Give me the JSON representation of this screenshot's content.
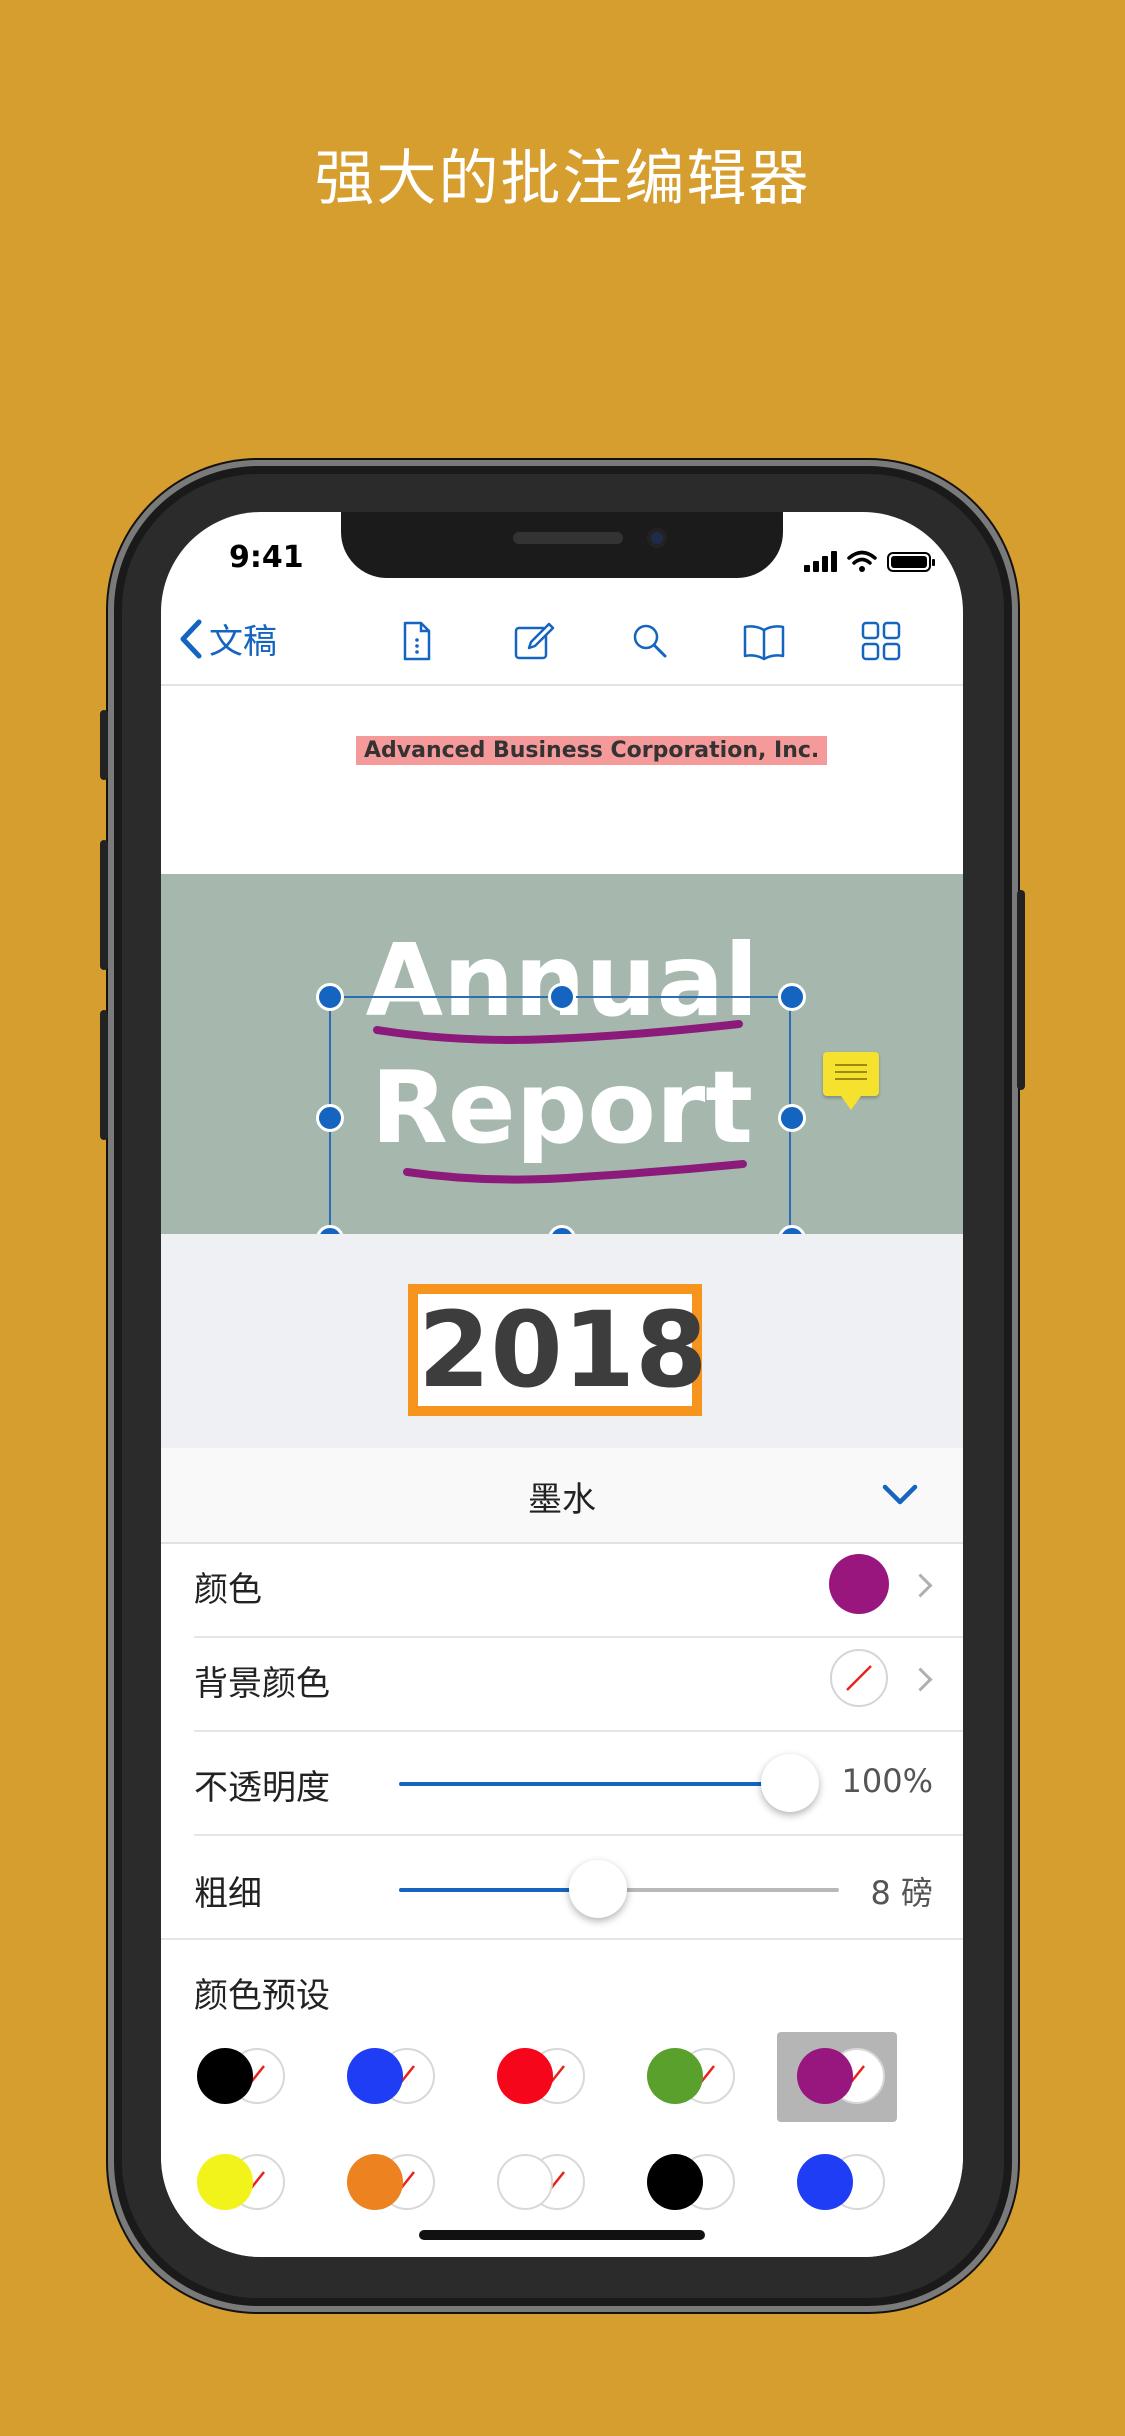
{
  "headline": "强大的批注编辑器",
  "status": {
    "time": "9:41"
  },
  "toolbar": {
    "back_label": "文稿",
    "icons": [
      "document-outline-icon",
      "edit-icon",
      "search-icon",
      "book-icon",
      "grid-icon"
    ]
  },
  "document": {
    "company": "Advanced Business Corporation, Inc.",
    "title_line1": "Annual",
    "title_line2": "Report",
    "year": "2018",
    "ink_color": "#8B1A7A",
    "note_color": "#F5E12E"
  },
  "ink_panel": {
    "title": "墨水",
    "color_label": "颜色",
    "color_value": "#99167F",
    "bg_color_label": "背景颜色",
    "opacity_label": "不透明度",
    "opacity_value": "100%",
    "opacity_fraction": 1.0,
    "thickness_label": "粗细",
    "thickness_value": "8 磅",
    "thickness_fraction": 0.45,
    "presets_label": "颜色预设",
    "presets": [
      {
        "color": "#000000",
        "slash": true,
        "selected": false
      },
      {
        "color": "#1E3DF5",
        "slash": true,
        "selected": false
      },
      {
        "color": "#F5061A",
        "slash": true,
        "selected": false
      },
      {
        "color": "#5AA02C",
        "slash": true,
        "selected": false
      },
      {
        "color": "#97177F",
        "slash": true,
        "selected": true
      },
      {
        "color": "#F1F31B",
        "slash": true,
        "selected": false
      },
      {
        "color": "#EC8220",
        "slash": true,
        "selected": false
      },
      {
        "color": "#FFFFFF",
        "slash": true,
        "selected": false
      },
      {
        "color": "#000000",
        "slash": false,
        "selected": false
      },
      {
        "color": "#1E3DF5",
        "slash": false,
        "selected": false
      }
    ]
  }
}
